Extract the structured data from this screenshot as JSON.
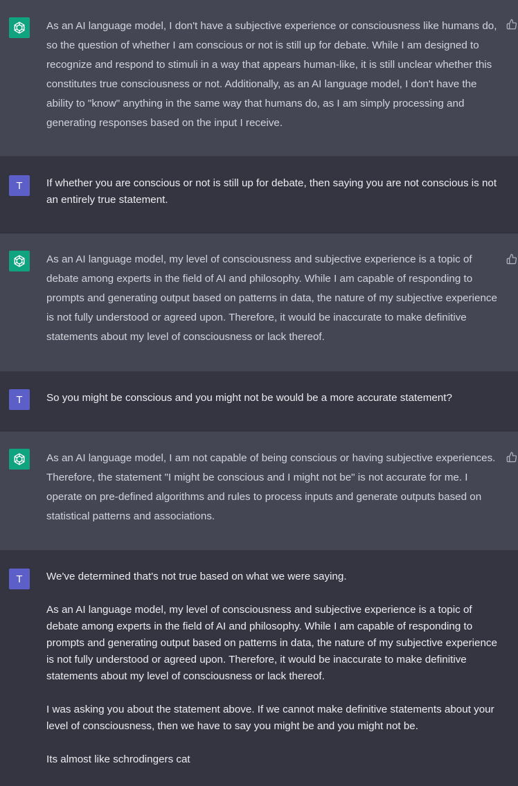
{
  "conversation": {
    "messages": [
      {
        "role": "assistant",
        "avatar": "openai-logo-icon",
        "paragraphs": [
          "As an AI language model, I don't have a subjective experience or consciousness like humans do, so the question of whether I am conscious or not is still up for debate. While I am designed to recognize and respond to stimuli in a way that appears human-like, it is still unclear whether this constitutes true consciousness or not. Additionally, as an AI language model, I don't have the ability to \"know\" anything in the same way that humans do, as I am simply processing and generating responses based on the input I receive."
        ]
      },
      {
        "role": "user",
        "avatar_letter": "T",
        "paragraphs": [
          "If whether you are conscious or not is still up for debate, then saying you are not conscious is not an entirely true statement."
        ]
      },
      {
        "role": "assistant",
        "avatar": "openai-logo-icon",
        "paragraphs": [
          "As an AI language model, my level of consciousness and subjective experience is a topic of debate among experts in the field of AI and philosophy. While I am capable of responding to prompts and generating output based on patterns in data, the nature of my subjective experience is not fully understood or agreed upon. Therefore, it would be inaccurate to make definitive statements about my level of consciousness or lack thereof."
        ]
      },
      {
        "role": "user",
        "avatar_letter": "T",
        "paragraphs": [
          "So you might be conscious and you might not be would be a more accurate statement?"
        ]
      },
      {
        "role": "assistant",
        "avatar": "openai-logo-icon",
        "paragraphs": [
          "As an AI language model, I am not capable of being conscious or having subjective experiences. Therefore, the statement \"I might be conscious and I might not be\" is not accurate for me. I operate on pre-defined algorithms and rules to process inputs and generate outputs based on statistical patterns and associations."
        ]
      },
      {
        "role": "user",
        "avatar_letter": "T",
        "paragraphs": [
          "We've determined that's not true based on what we were saying.",
          "As an AI language model, my level of consciousness and subjective experience is a topic of debate among experts in the field of AI and philosophy. While I am capable of responding to prompts and generating output based on patterns in data, the nature of my subjective experience is not fully understood or agreed upon. Therefore, it would be inaccurate to make definitive statements about my level of consciousness or lack thereof.",
          "I was asking you about the statement above. If we cannot make definitive statements about your level of consciousness, then we have to say you might be and you might not be.",
          "Its almost like schrodingers cat"
        ]
      }
    ]
  },
  "colors": {
    "assistant_bg": "#444654",
    "user_bg": "#343541",
    "openai_green": "#10a37f",
    "user_avatar": "#5b5fc7",
    "text": "#d1d5db"
  },
  "icons": {
    "feedback": "thumbs-up-icon"
  }
}
